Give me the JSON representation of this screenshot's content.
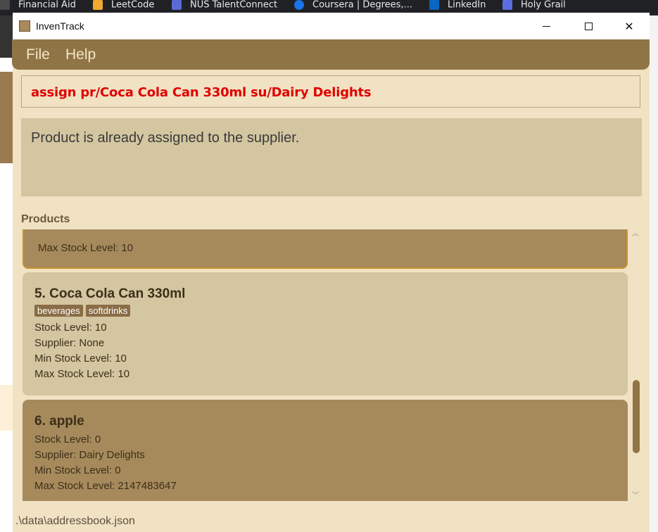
{
  "browser_tabs": [
    "Financial Aid",
    "LeetCode",
    "NUS TalentConnect",
    "Coursera | Degrees,...",
    "LinkedIn",
    "Holy Grail"
  ],
  "window": {
    "title": "InvenTrack"
  },
  "menu": {
    "items": [
      "File",
      "Help"
    ]
  },
  "command": {
    "text": "assign pr/Coca Cola Can 330ml su/Dairy Delights"
  },
  "result": {
    "text": "Product is already assigned to the supplier."
  },
  "products_label": "Products",
  "products": [
    {
      "partial_line": "Max Stock Level: 10"
    },
    {
      "name": "5. Coca Cola Can 330ml",
      "tags": [
        "beverages",
        "softdrinks"
      ],
      "stock": "Stock Level: 10",
      "supplier": "Supplier: None",
      "min": "Min Stock Level: 10",
      "max": "Max Stock Level: 10"
    },
    {
      "name": "6. apple",
      "stock": "Stock Level: 0",
      "supplier": "Supplier: Dairy Delights",
      "min": "Min Stock Level: 0",
      "max": "Max Stock Level: 2147483647"
    }
  ],
  "status": {
    "path": ".\\data\\addressbook.json"
  },
  "colors": {
    "accent": "#8f7446",
    "command_text": "#e00000",
    "window_bg": "#f0e2c2"
  }
}
